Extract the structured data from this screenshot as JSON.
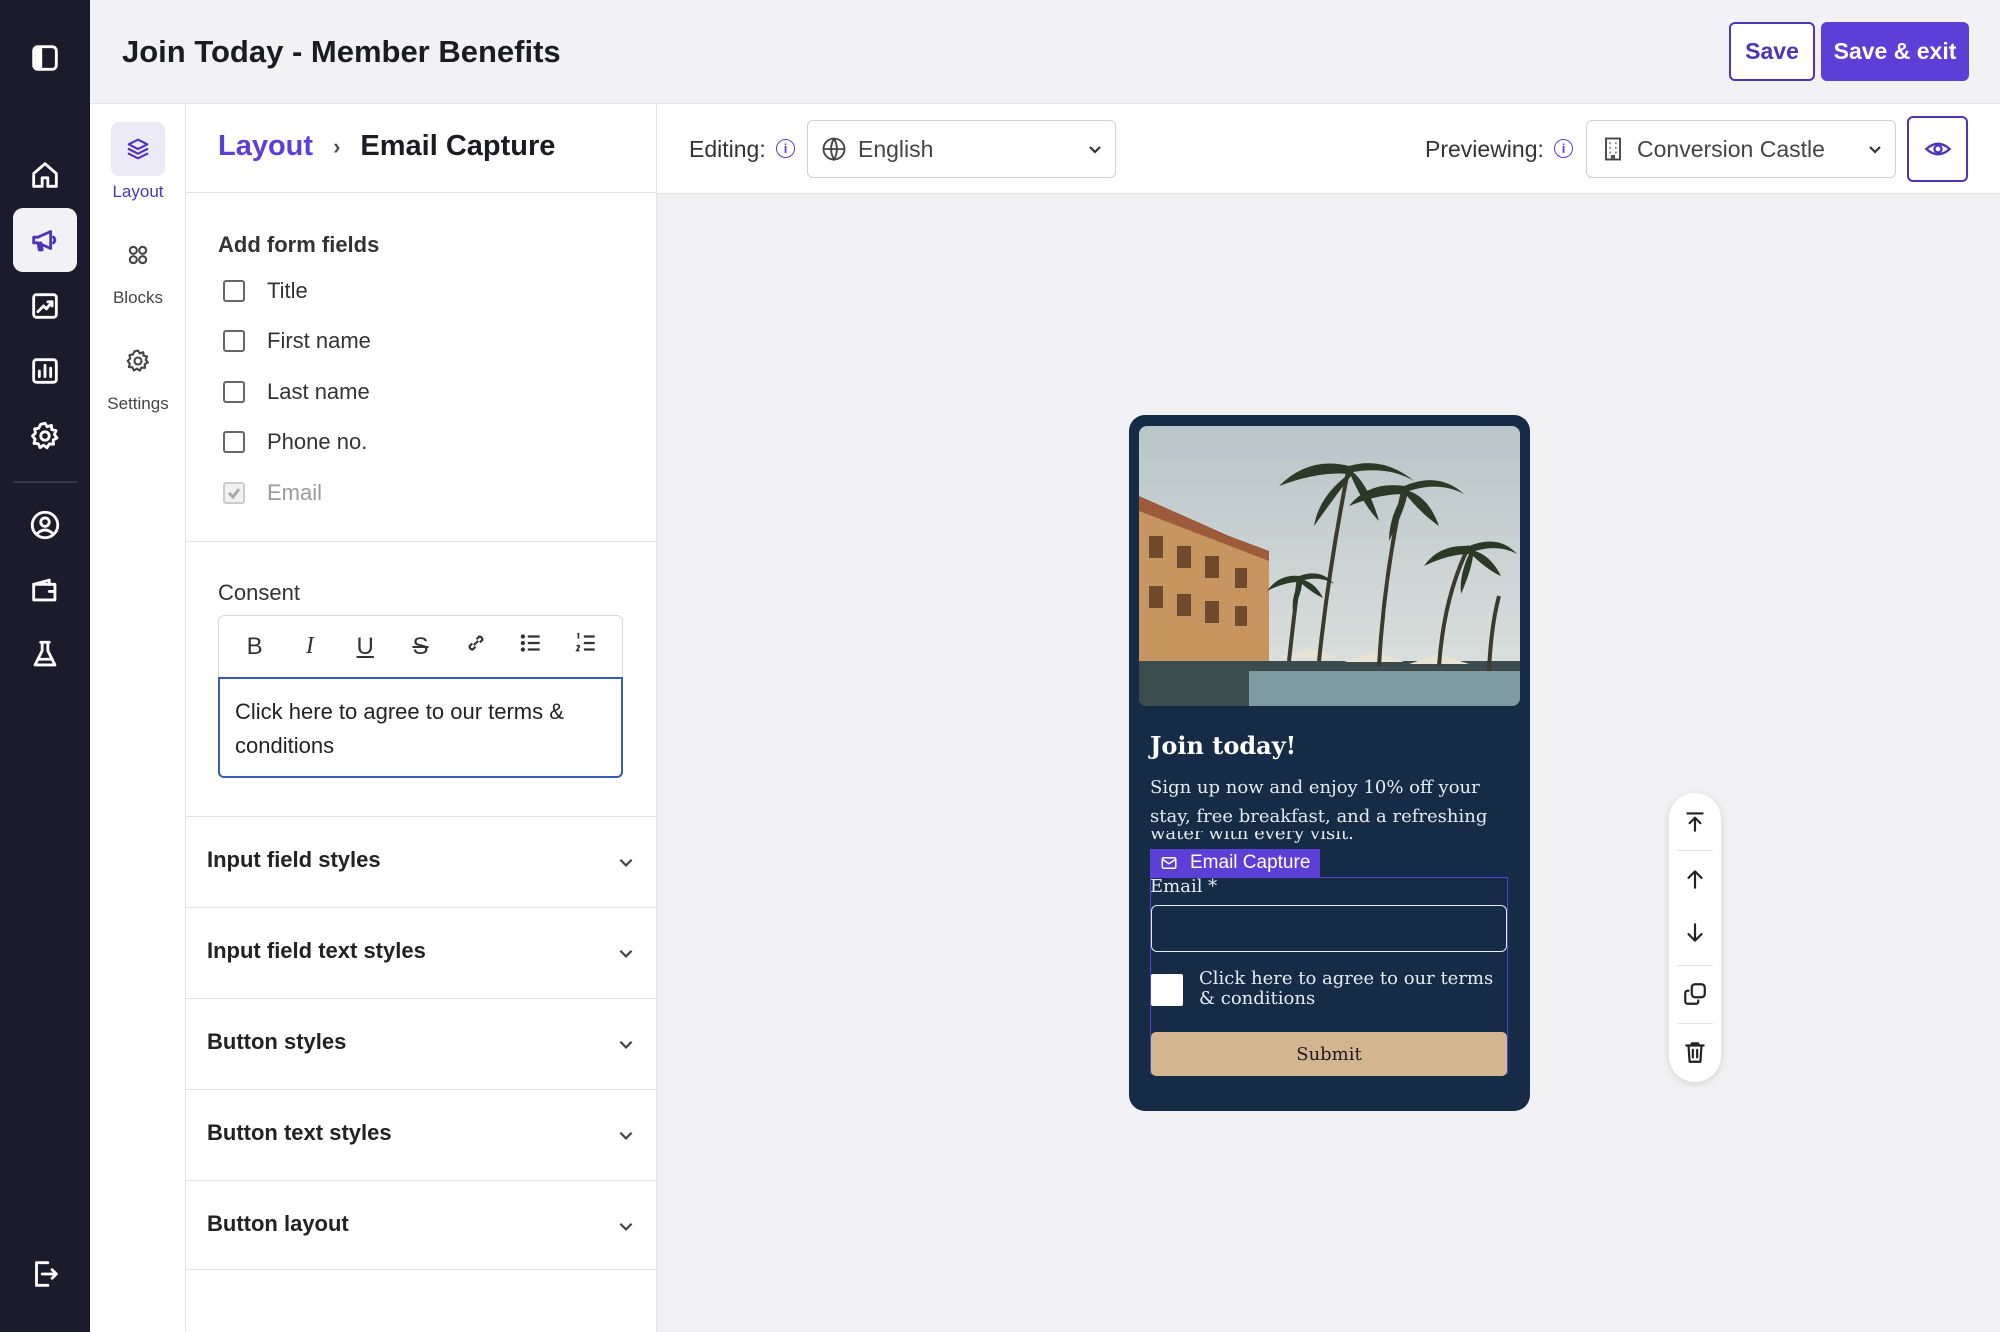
{
  "header": {
    "title": "Join Today - Member Benefits",
    "save_label": "Save",
    "save_exit_label": "Save & exit"
  },
  "rail": {
    "items": [
      "sidebar-toggle-icon",
      "home-icon",
      "megaphone-icon",
      "trending-chart-icon",
      "bar-chart-icon",
      "gear-icon",
      "user-circle-icon",
      "wallet-icon",
      "flask-icon",
      "logout-icon"
    ],
    "active": "megaphone-icon"
  },
  "subnav": {
    "items": [
      {
        "label": "Layout",
        "icon": "layers-icon",
        "active": true
      },
      {
        "label": "Blocks",
        "icon": "blocks-icon",
        "active": false
      },
      {
        "label": "Settings",
        "icon": "gear-icon",
        "active": false
      }
    ]
  },
  "panel": {
    "breadcrumb": {
      "parent": "Layout",
      "separator": "›",
      "current": "Email Capture"
    },
    "form_fields_heading": "Add form fields",
    "fields": [
      {
        "label": "Title",
        "checked": false,
        "disabled": false
      },
      {
        "label": "First name",
        "checked": false,
        "disabled": false
      },
      {
        "label": "Last name",
        "checked": false,
        "disabled": false
      },
      {
        "label": "Phone no.",
        "checked": false,
        "disabled": false
      },
      {
        "label": "Email",
        "checked": true,
        "disabled": true
      }
    ],
    "consent_label": "Consent",
    "rte_tools": [
      "B",
      "I",
      "U",
      "S",
      "link-icon",
      "bulleted-list-icon",
      "numbered-list-icon"
    ],
    "consent_text": "Click here to agree to our terms & conditions",
    "accordions": [
      "Input field styles",
      "Input field text styles",
      "Button styles",
      "Button text styles",
      "Button layout"
    ]
  },
  "toolbar": {
    "editing_label": "Editing:",
    "language": "English",
    "previewing_label": "Previewing:",
    "preview_target": "Conversion Castle",
    "device_active": "desktop"
  },
  "preview": {
    "title": "Join today!",
    "body": "Sign up now and enjoy 10% off your stay, free breakfast, and a refreshing bottle of water with every visit.",
    "body_visible_end": "water with every visit.",
    "block_tag": "Email Capture",
    "email_label": "Email *",
    "consent": "Click here to agree to our terms & conditions",
    "submit_label": "Submit"
  },
  "colors": {
    "accent": "#5b3fd6",
    "rail_bg": "#1c1b2b",
    "phone_bg": "#162b45",
    "submit_bg": "#d3b590"
  }
}
